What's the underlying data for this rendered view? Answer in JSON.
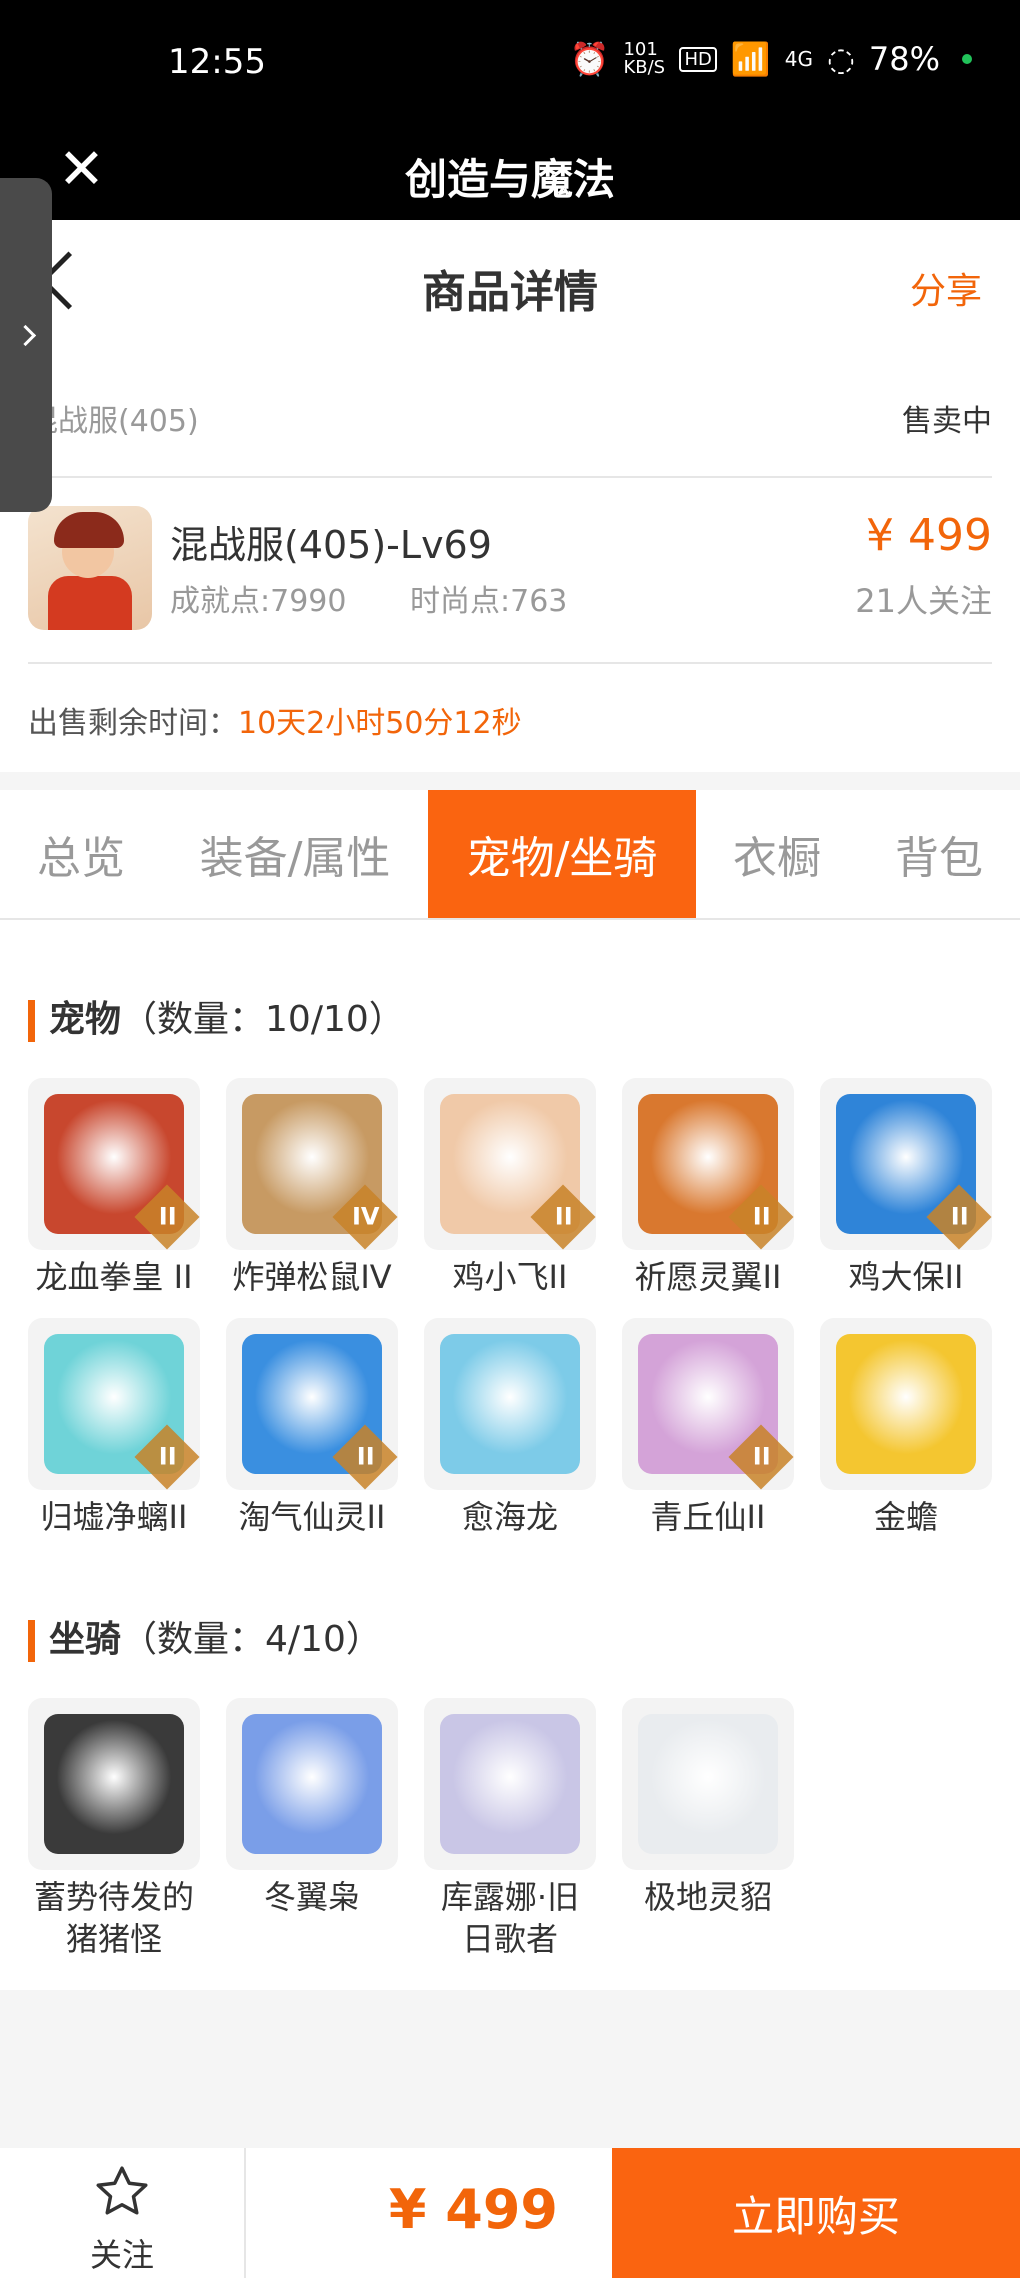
{
  "status_bar": {
    "time": "12:55",
    "net_speed": "101 KB/S",
    "hd": "HD",
    "signal": "4G",
    "battery": "78%"
  },
  "app_bar": {
    "title": "创造与魔法"
  },
  "header": {
    "title": "商品详情",
    "share": "分享"
  },
  "server": {
    "name": "混战服(405)",
    "status": "售卖中"
  },
  "item": {
    "name": "混战服(405)-Lv69",
    "achievement": "成就点:7990",
    "fashion": "时尚点:763",
    "price": "¥ 499",
    "followers": "21人关注"
  },
  "remaining": {
    "label": "出售剩余时间：",
    "value": "10天2小时50分12秒"
  },
  "tabs": [
    "总览",
    "装备/属性",
    "宠物/坐骑",
    "衣橱",
    "背包"
  ],
  "active_tab": "宠物/坐骑",
  "pets": {
    "title": "宠物",
    "count": "（数量：10/10）",
    "items": [
      {
        "name": "龙血拳皇 II",
        "grade": "II",
        "color": "#c8472e"
      },
      {
        "name": "炸弹松鼠IV",
        "grade": "IV",
        "color": "#c79a63"
      },
      {
        "name": "鸡小飞II",
        "grade": "II",
        "color": "#f0c9a8"
      },
      {
        "name": "祈愿灵翼II",
        "grade": "II",
        "color": "#d9782f"
      },
      {
        "name": "鸡大保II",
        "grade": "II",
        "color": "#2f84d8"
      },
      {
        "name": "归墟净螭II",
        "grade": "II",
        "color": "#6fd3d8"
      },
      {
        "name": "淘气仙灵II",
        "grade": "II",
        "color": "#3a8fe0"
      },
      {
        "name": "愈海龙",
        "grade": "",
        "color": "#7dcbe8"
      },
      {
        "name": "青丘仙II",
        "grade": "II",
        "color": "#d4a3d8"
      },
      {
        "name": "金蟾",
        "grade": "",
        "color": "#f4c630"
      }
    ]
  },
  "mounts": {
    "title": "坐骑",
    "count": "（数量：4/10）",
    "items": [
      {
        "name": "蓄势待发的\n猪猪怪",
        "color": "#3a3a3a"
      },
      {
        "name": "冬翼枭",
        "color": "#7a9ee8"
      },
      {
        "name": "库露娜·旧\n日歌者",
        "color": "#c9c6e6"
      },
      {
        "name": "极地灵貂",
        "color": "#e9ecef"
      }
    ]
  },
  "footer": {
    "follow": "关注",
    "price": "¥ 499",
    "buy": "立即购买"
  }
}
